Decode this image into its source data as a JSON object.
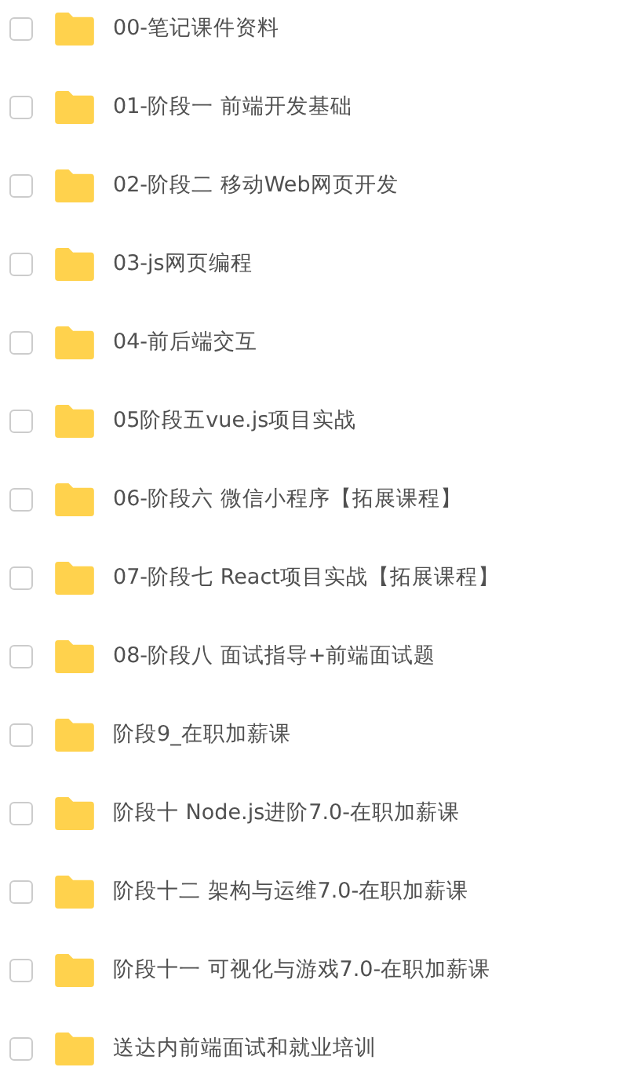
{
  "files": [
    {
      "name": "00-笔记课件资料",
      "checked": false
    },
    {
      "name": "01-阶段一 前端开发基础",
      "checked": false
    },
    {
      "name": "02-阶段二 移动Web网页开发",
      "checked": false
    },
    {
      "name": "03-js网页编程",
      "checked": false
    },
    {
      "name": "04-前后端交互",
      "checked": false
    },
    {
      "name": "05阶段五vue.js项目实战",
      "checked": false
    },
    {
      "name": "06-阶段六 微信小程序【拓展课程】",
      "checked": false
    },
    {
      "name": "07-阶段七 React项目实战【拓展课程】",
      "checked": false
    },
    {
      "name": "08-阶段八 面试指导+前端面试题",
      "checked": false
    },
    {
      "name": "阶段9_在职加薪课",
      "checked": false
    },
    {
      "name": "阶段十 Node.js进阶7.0-在职加薪课",
      "checked": false
    },
    {
      "name": "阶段十二 架构与运维7.0-在职加薪课",
      "checked": false
    },
    {
      "name": "阶段十一 可视化与游戏7.0-在职加薪课",
      "checked": false
    },
    {
      "name": "送达内前端面试和就业培训",
      "checked": false
    }
  ]
}
